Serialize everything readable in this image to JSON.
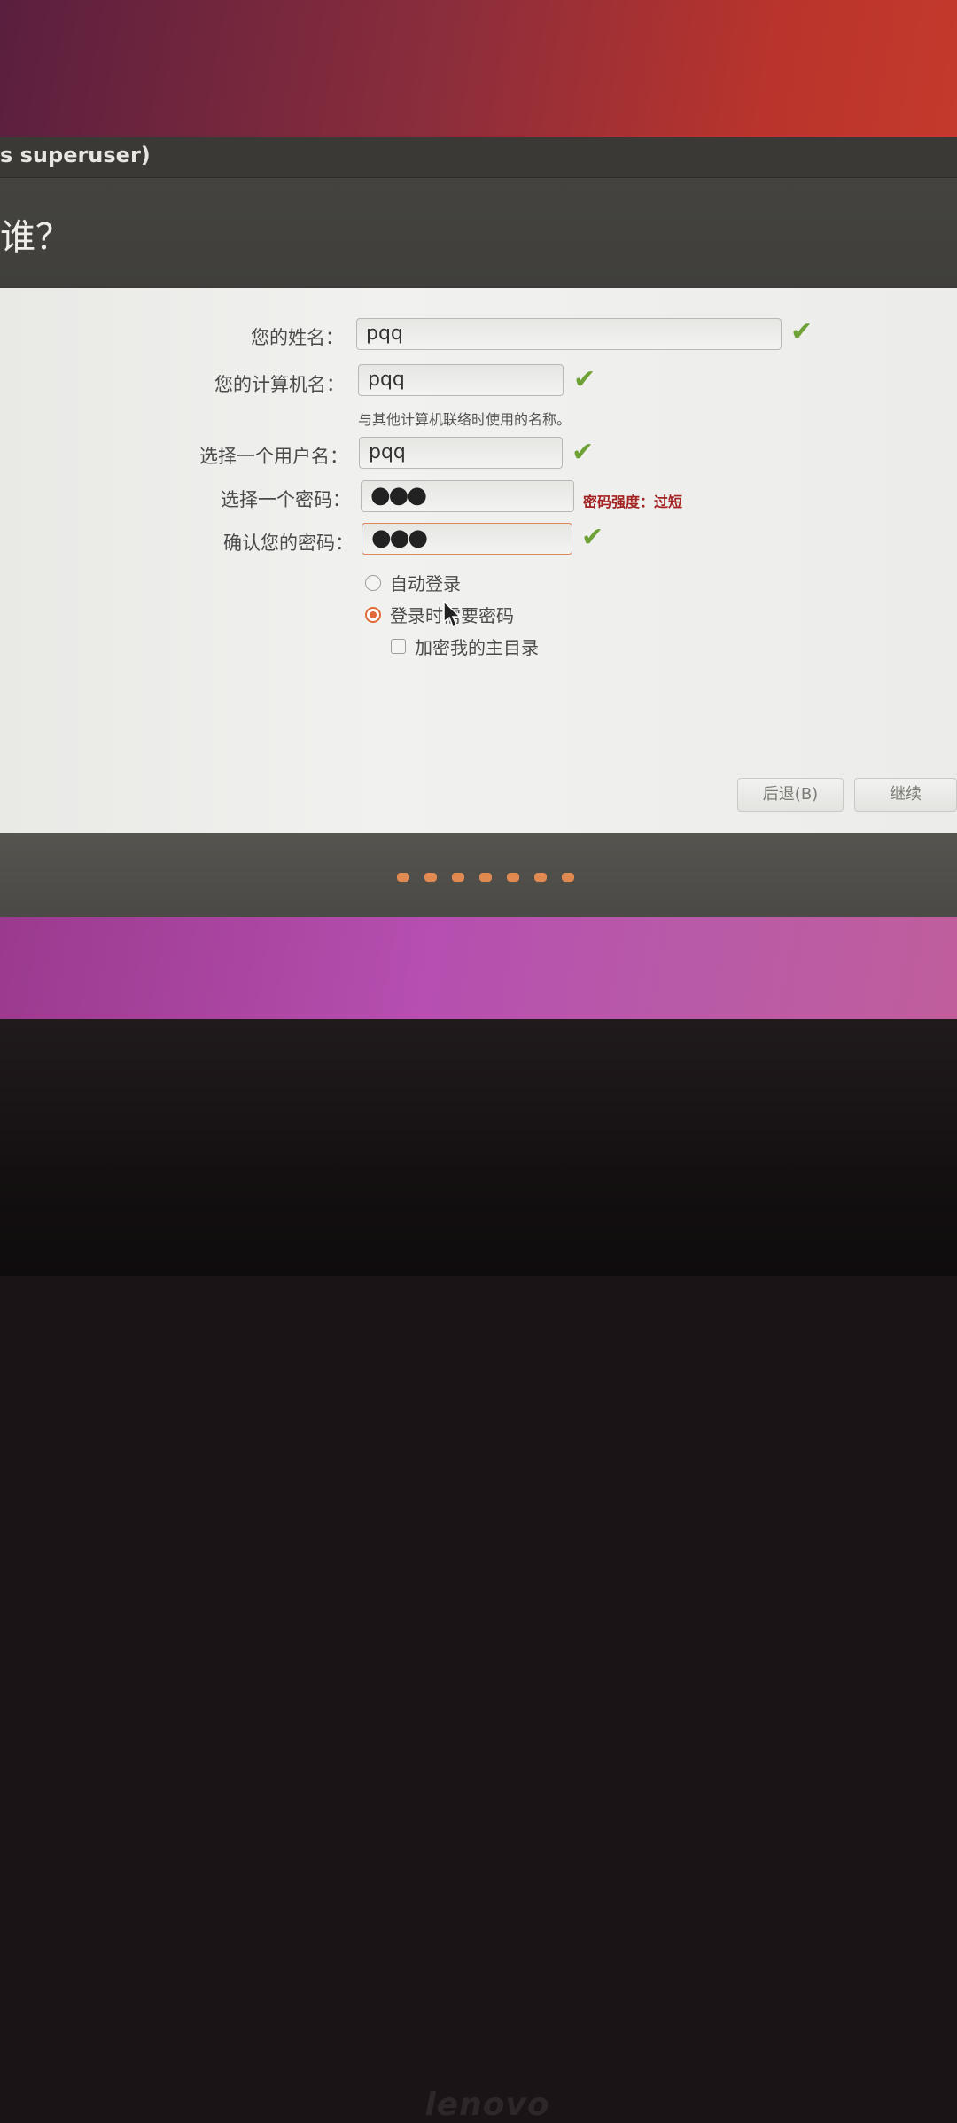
{
  "window": {
    "title": "s superuser)",
    "page_title": "谁？"
  },
  "form": {
    "name_label": "您的姓名：",
    "name_value": "pqq",
    "computer_label": "您的计算机名：",
    "computer_value": "pqq",
    "computer_hint": "与其他计算机联络时使用的名称。",
    "username_label": "选择一个用户名：",
    "username_value": "pqq",
    "password_label": "选择一个密码：",
    "password_value": "●●●",
    "password_strength": "密码强度：过短",
    "confirm_label": "确认您的密码：",
    "confirm_value": "●●●"
  },
  "options": {
    "auto_login": "自动登录",
    "require_password": "登录时需要密码",
    "encrypt_home": "加密我的主目录",
    "selected": "require_password",
    "encrypt_home_checked": false
  },
  "buttons": {
    "back": "后退(B)",
    "continue": "继续"
  },
  "progress": {
    "total_steps": 7
  },
  "brand": {
    "logo_text": "lenovo"
  },
  "icons": {
    "valid": "check-icon",
    "cursor": "mouse-pointer-icon"
  },
  "colors": {
    "accent": "#e06a3a",
    "valid": "#6ea236",
    "warning": "#a32222"
  }
}
